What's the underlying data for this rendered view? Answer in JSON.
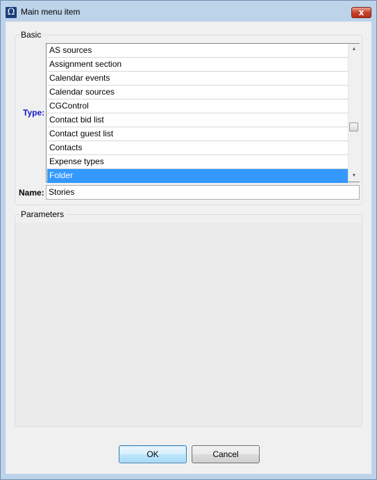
{
  "window": {
    "title": "Main menu item",
    "app_icon_glyph": "Ω",
    "close_glyph": "x"
  },
  "basic": {
    "legend": "Basic",
    "type_label": "Type:",
    "name_label": "Name:",
    "name_value": "Stories",
    "type_options": [
      "AS sources",
      "Assignment section",
      "Calendar events",
      "Calendar sources",
      "CGControl",
      "Contact bid list",
      "Contact guest list",
      "Contacts",
      "Expense types",
      "Folder"
    ],
    "selected_type": "Folder"
  },
  "parameters": {
    "legend": "Parameters"
  },
  "buttons": {
    "ok_label": "OK",
    "cancel_label": "Cancel"
  },
  "colors": {
    "selection": "#3399ff",
    "type_label": "#1414c8",
    "close_button": "#c8412c"
  }
}
